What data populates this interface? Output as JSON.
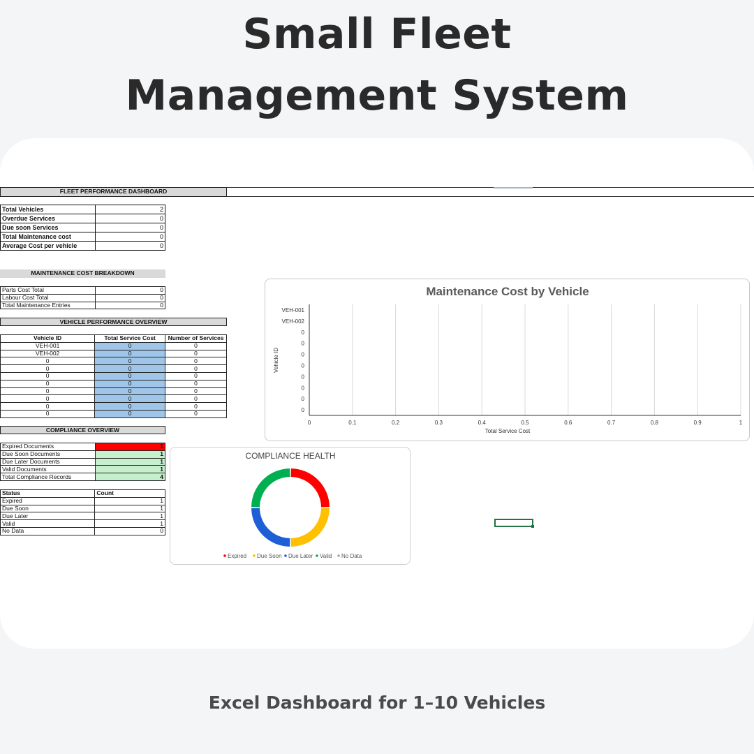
{
  "header": {
    "title_line1": "Small Fleet",
    "title_line2": "Management System"
  },
  "footer": {
    "subtitle": "Excel Dashboard for 1–10 Vehicles"
  },
  "fleet_performance": {
    "header": "FLEET PERFORMANCE DASHBOARD",
    "rows": [
      {
        "label": "Total Vehicles",
        "value": "2"
      },
      {
        "label": "Overdue Services",
        "value": "0"
      },
      {
        "label": "Due soon Services",
        "value": "0"
      },
      {
        "label": "Total Maintenance cost",
        "value": "0"
      },
      {
        "label": "Average Cost per vehicle",
        "value": "0"
      }
    ]
  },
  "maintenance_breakdown": {
    "header": "MAINTENANCE COST BREAKDOWN",
    "rows": [
      {
        "label": "Parts Cost Total",
        "value": "0"
      },
      {
        "label": "Labour Cost Total",
        "value": "0"
      },
      {
        "label": "Total Maintenance Entries",
        "value": "0"
      }
    ]
  },
  "vehicle_performance": {
    "header": "VEHICLE PERFORMANCE OVERVIEW",
    "columns": [
      "Vehicle ID",
      "Total Service Cost",
      "Number of Services"
    ],
    "rows": [
      [
        "VEH-001",
        "0",
        "0"
      ],
      [
        "VEH-002",
        "0",
        "0"
      ],
      [
        "0",
        "0",
        "0"
      ],
      [
        "0",
        "0",
        "0"
      ],
      [
        "0",
        "0",
        "0"
      ],
      [
        "0",
        "0",
        "0"
      ],
      [
        "0",
        "0",
        "0"
      ],
      [
        "0",
        "0",
        "0"
      ],
      [
        "0",
        "0",
        "0"
      ],
      [
        "0",
        "0",
        "0"
      ]
    ]
  },
  "compliance_overview": {
    "header": "COMPLIANCE OVERVIEW",
    "rows": [
      {
        "label": "Expired Documents",
        "value": "1",
        "color": "#ff0000"
      },
      {
        "label": "Due Soon Documents",
        "value": "1",
        "color": "#c6efce"
      },
      {
        "label": "Due Later Documents",
        "value": "1",
        "color": "#c6efce"
      },
      {
        "label": "Valid Documents",
        "value": "1",
        "color": "#c6efce"
      },
      {
        "label": "Total Compliance Records",
        "value": "4",
        "color": "#c6efce"
      }
    ]
  },
  "status_table": {
    "columns": [
      "Status",
      "Count"
    ],
    "rows": [
      [
        "Expired",
        "1"
      ],
      [
        "Due Soon",
        "1"
      ],
      [
        "Due Later",
        "1"
      ],
      [
        "Valid",
        "1"
      ],
      [
        "No Data",
        "0"
      ]
    ]
  },
  "chart_data": [
    {
      "type": "bar",
      "orientation": "horizontal",
      "title": "Maintenance Cost by Vehicle",
      "xlabel": "Total Service Cost",
      "ylabel": "Vehicle ID",
      "categories": [
        "VEH-001",
        "VEH-002",
        "0",
        "0",
        "0",
        "0",
        "0",
        "0",
        "0",
        "0"
      ],
      "values": [
        0,
        0,
        0,
        0,
        0,
        0,
        0,
        0,
        0,
        0
      ],
      "xlim": [
        0,
        1
      ],
      "xticks": [
        "0",
        "0.1",
        "0.2",
        "0.3",
        "0.4",
        "0.5",
        "0.6",
        "0.7",
        "0.8",
        "0.9",
        "1"
      ],
      "grid": "vertical"
    },
    {
      "type": "pie",
      "variant": "doughnut",
      "title": "COMPLIANCE HEALTH",
      "categories": [
        "Expired",
        "Due Soon",
        "Due Later",
        "Valid",
        "No Data"
      ],
      "values": [
        1,
        1,
        1,
        1,
        0
      ],
      "colors": [
        "#ff0000",
        "#ffc000",
        "#1f5fd6",
        "#00b050",
        "#a5a5a5"
      ],
      "legend": "bottom"
    }
  ]
}
